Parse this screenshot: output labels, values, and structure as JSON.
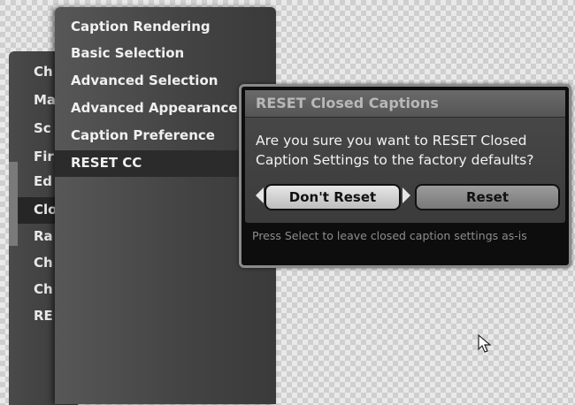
{
  "main_menu": {
    "items": [
      {
        "label": "Ch"
      },
      {
        "label": "Ma"
      },
      {
        "label": "Sc"
      },
      {
        "label": "Fir"
      },
      {
        "label": "Ed"
      },
      {
        "label": "Clo"
      },
      {
        "label": "Ra"
      },
      {
        "label": "Ch"
      },
      {
        "label": "Ch"
      },
      {
        "label": "RE"
      }
    ]
  },
  "cc_menu": {
    "items": [
      {
        "label": "Caption Rendering"
      },
      {
        "label": "Basic Selection"
      },
      {
        "label": "Advanced Selection"
      },
      {
        "label": "Advanced Appearance"
      },
      {
        "label": "Caption Preference"
      },
      {
        "label": "RESET CC"
      }
    ]
  },
  "dialog": {
    "title": "RESET Closed Captions",
    "message": "Are you sure you want to RESET Closed Caption Settings to the factory defaults?",
    "cancel_label": "Don't Reset",
    "confirm_label": "Reset",
    "hint": "Press Select to leave closed caption settings as-is"
  },
  "icons": {
    "left_arrow": "triangle-left-icon",
    "right_arrow": "triangle-right-icon",
    "cursor": "mouse-pointer-icon"
  }
}
